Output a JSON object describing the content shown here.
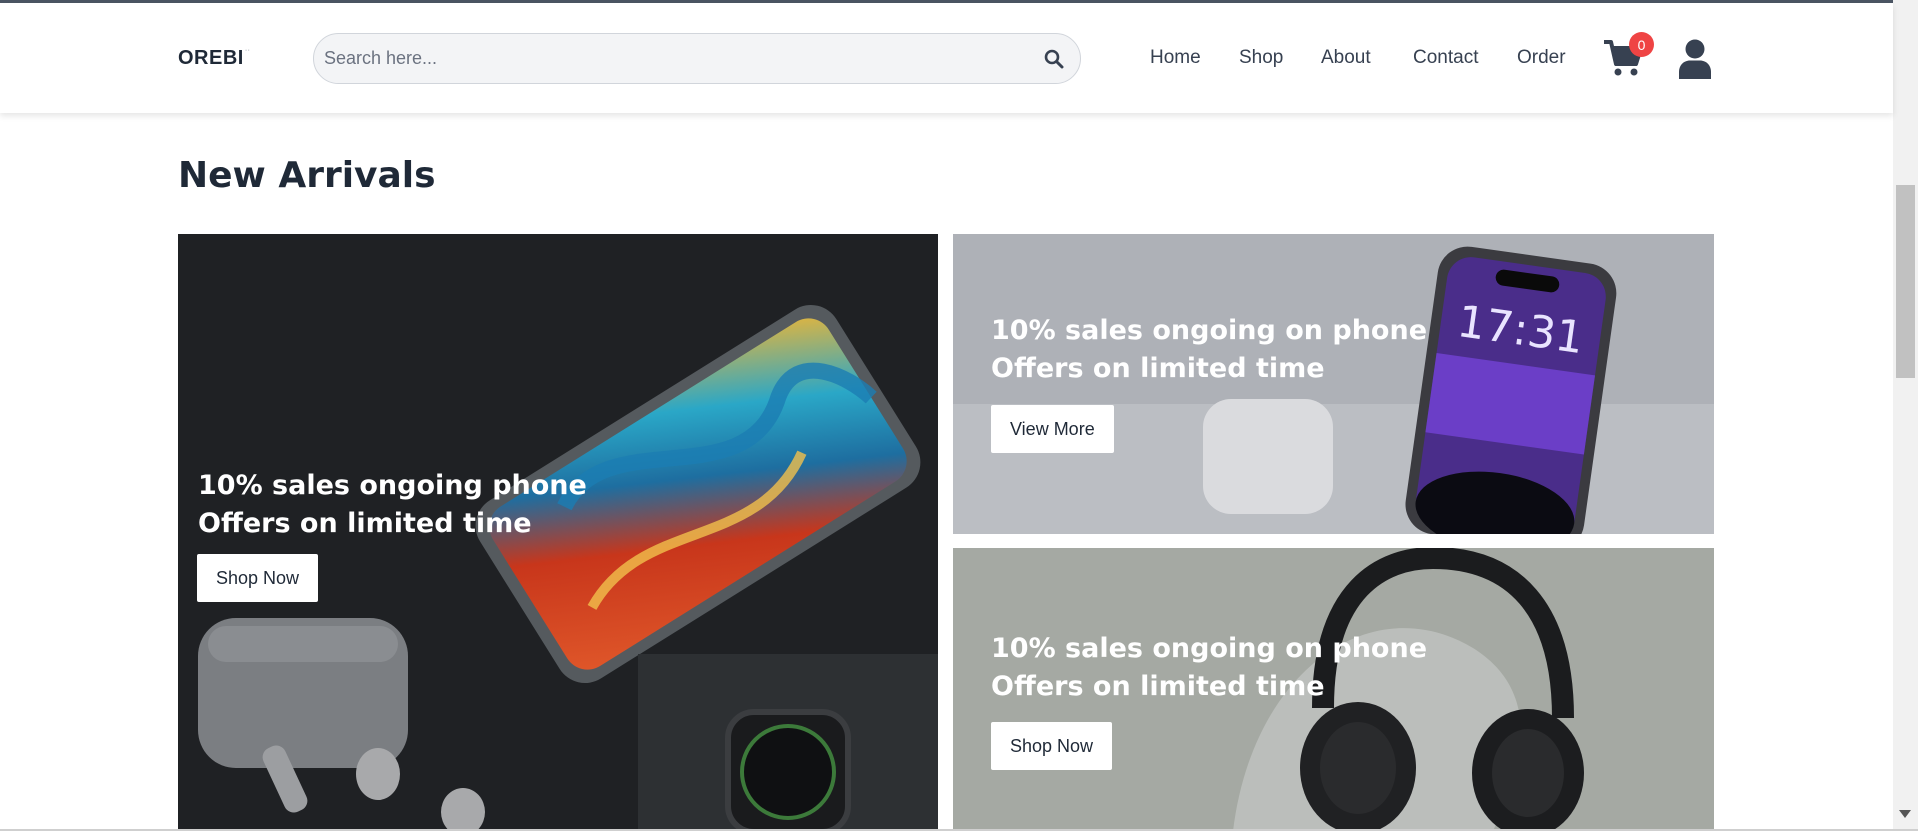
{
  "header": {
    "logo": "OREBI",
    "logo_mark": "··",
    "search_placeholder": "Search here...",
    "nav": [
      "Home",
      "Shop",
      "About",
      "Contact",
      "Order"
    ],
    "cart_count": "0"
  },
  "page_title": "New Arrivals",
  "banners": [
    {
      "line1": "10% sales ongoing phone",
      "line2": "Offers on limited time",
      "button": "Shop Now"
    },
    {
      "line1": "10% sales ongoing on phone",
      "line2": "Offers on limited time",
      "button": "View More"
    },
    {
      "line1": "10% sales ongoing on phone",
      "line2": "Offers on limited time",
      "button": "Shop Now"
    }
  ],
  "colors": {
    "badge": "#ef4444",
    "text_dark": "#1f2937"
  }
}
